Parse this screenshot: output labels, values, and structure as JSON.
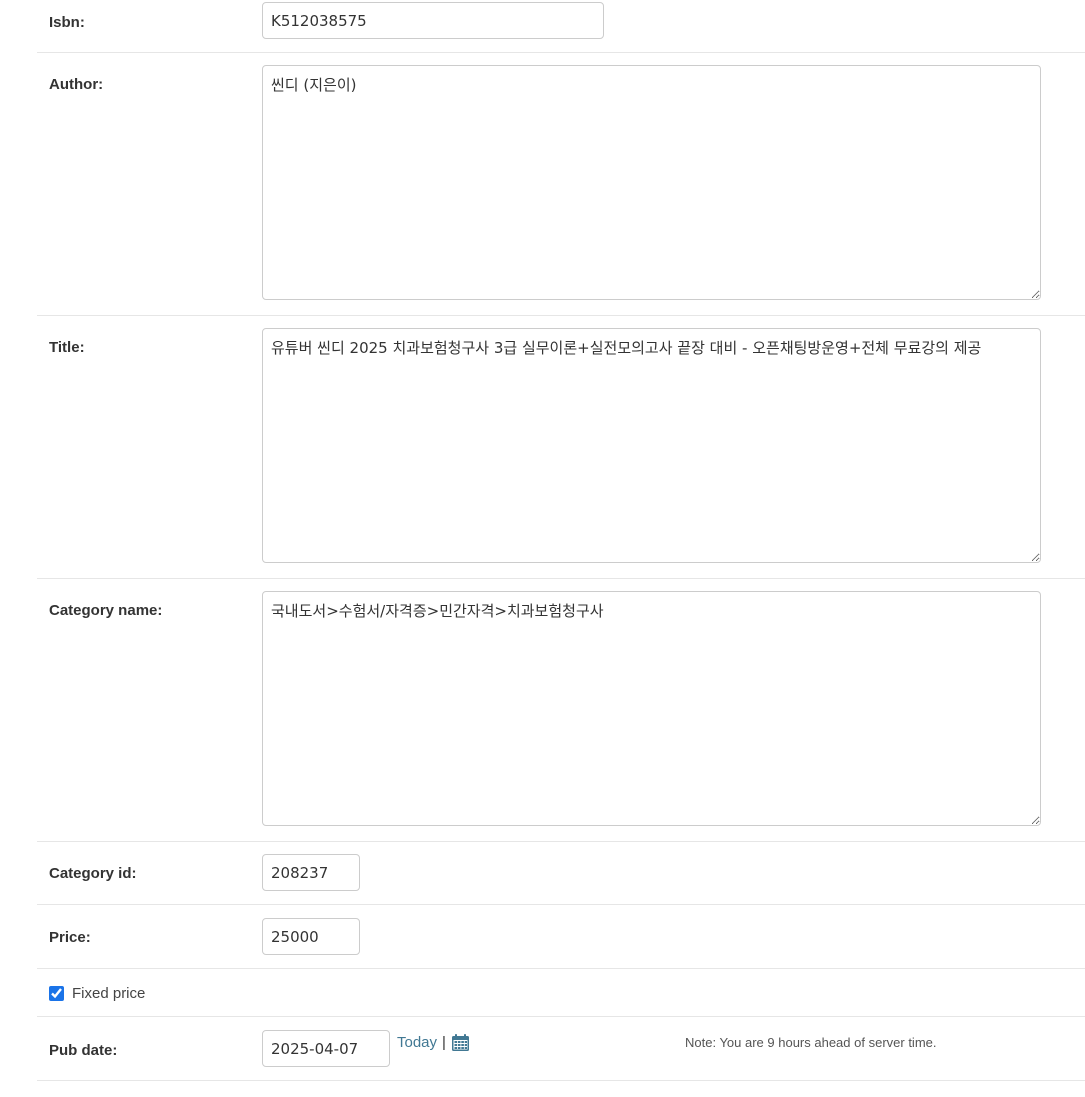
{
  "fields": {
    "isbn": {
      "label": "Isbn:",
      "value": "K512038575"
    },
    "author": {
      "label": "Author:",
      "value": "씬디 (지은이)"
    },
    "title": {
      "label": "Title:",
      "value": "유튜버 씬디 2025 치과보험청구사 3급 실무이론+실전모의고사 끝장 대비 - 오픈채팅방운영+전체 무료강의 제공"
    },
    "category_name": {
      "label": "Category name:",
      "value": "국내도서>수험서/자격증>민간자격>치과보험청구사"
    },
    "category_id": {
      "label": "Category id:",
      "value": "208237"
    },
    "price": {
      "label": "Price:",
      "value": "25000"
    },
    "fixed_price": {
      "label": "Fixed price",
      "checked": true
    },
    "pub_date": {
      "label": "Pub date:",
      "value": "2025-04-07",
      "today_link": "Today",
      "separator": "|",
      "calendar_icon": "calendar-icon",
      "note": "Note: You are 9 hours ahead of server time."
    }
  },
  "colors": {
    "link": "#417893",
    "checkbox_accent": "#1a73e8",
    "border": "#cccccc",
    "divider": "#e6e6e6"
  }
}
